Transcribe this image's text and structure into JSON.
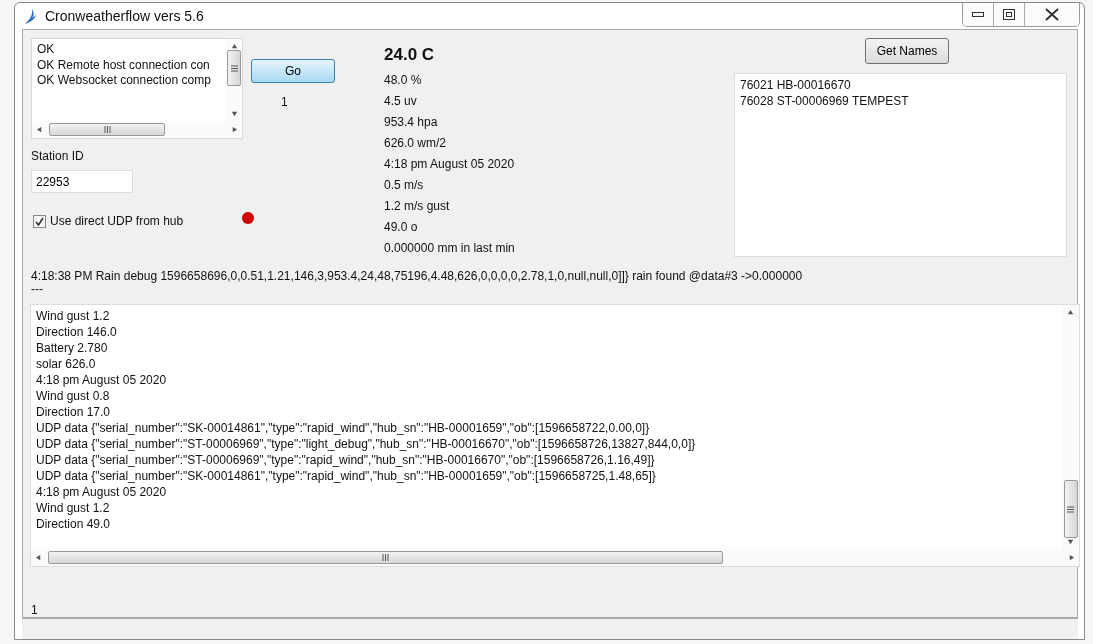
{
  "window": {
    "title": "Cronweatherflow vers 5.6"
  },
  "status_list": {
    "items": [
      "OK",
      "OK Remote host connection con",
      "OK Websocket connection comp"
    ]
  },
  "go_button": {
    "label": "Go",
    "count": "1"
  },
  "station_id": {
    "label": "Station ID",
    "value": "22953"
  },
  "udp_checkbox": {
    "label": "Use direct UDP from hub",
    "checked": true
  },
  "readings": [
    {
      "text": "24.0 C",
      "kind": "headline"
    },
    {
      "text": "48.0 %",
      "kind": "value"
    },
    {
      "text": "4.5 uv",
      "kind": "value"
    },
    {
      "text": "953.4 hpa",
      "kind": "value"
    },
    {
      "text": "626.0 wm/2",
      "kind": "value"
    },
    {
      "text": "4:18 pm August 05 2020",
      "kind": "value"
    },
    {
      "text": "0.5 m/s",
      "kind": "value"
    },
    {
      "text": "1.2 m/s gust",
      "kind": "value"
    },
    {
      "text": "49.0 o",
      "kind": "value"
    },
    {
      "text": "0.000000 mm in last min",
      "kind": "value"
    }
  ],
  "get_names_button": {
    "label": "Get Names"
  },
  "names_list": {
    "items": [
      "76021 HB-00016670",
      "76028 ST-00006969 TEMPEST"
    ]
  },
  "debug_line": "4:18:38 PM Rain debug 1596658696,0,0.51,1.21,146,3,953.4,24,48,75196,4.48,626,0,0,0,0,2.78,1,0,null,null,0]]} rain found @data#3 ->0.000000",
  "debug_separator": "---",
  "log_lines": [
    "Wind gust 1.2",
    "Direction 146.0",
    "Battery 2.780",
    "solar 626.0",
    "4:18 pm August 05 2020",
    "Wind gust 0.8",
    "Direction 17.0",
    "UDP data {\"serial_number\":\"SK-00014861\",\"type\":\"rapid_wind\",\"hub_sn\":\"HB-00001659\",\"ob\":[1596658722,0.00,0]}",
    "UDP data {\"serial_number\":\"ST-00006969\",\"type\":\"light_debug\",\"hub_sn\":\"HB-00016670\",\"ob\":[1596658726,13827,844,0,0]}",
    "UDP data {\"serial_number\":\"ST-00006969\",\"type\":\"rapid_wind\",\"hub_sn\":\"HB-00016670\",\"ob\":[1596658726,1.16,49]}",
    "UDP data {\"serial_number\":\"SK-00014861\",\"type\":\"rapid_wind\",\"hub_sn\":\"HB-00001659\",\"ob\":[1596658725,1.48,65]}",
    "4:18 pm August 05 2020",
    "Wind gust 1.2",
    "Direction 49.0"
  ],
  "footer_count": "1"
}
